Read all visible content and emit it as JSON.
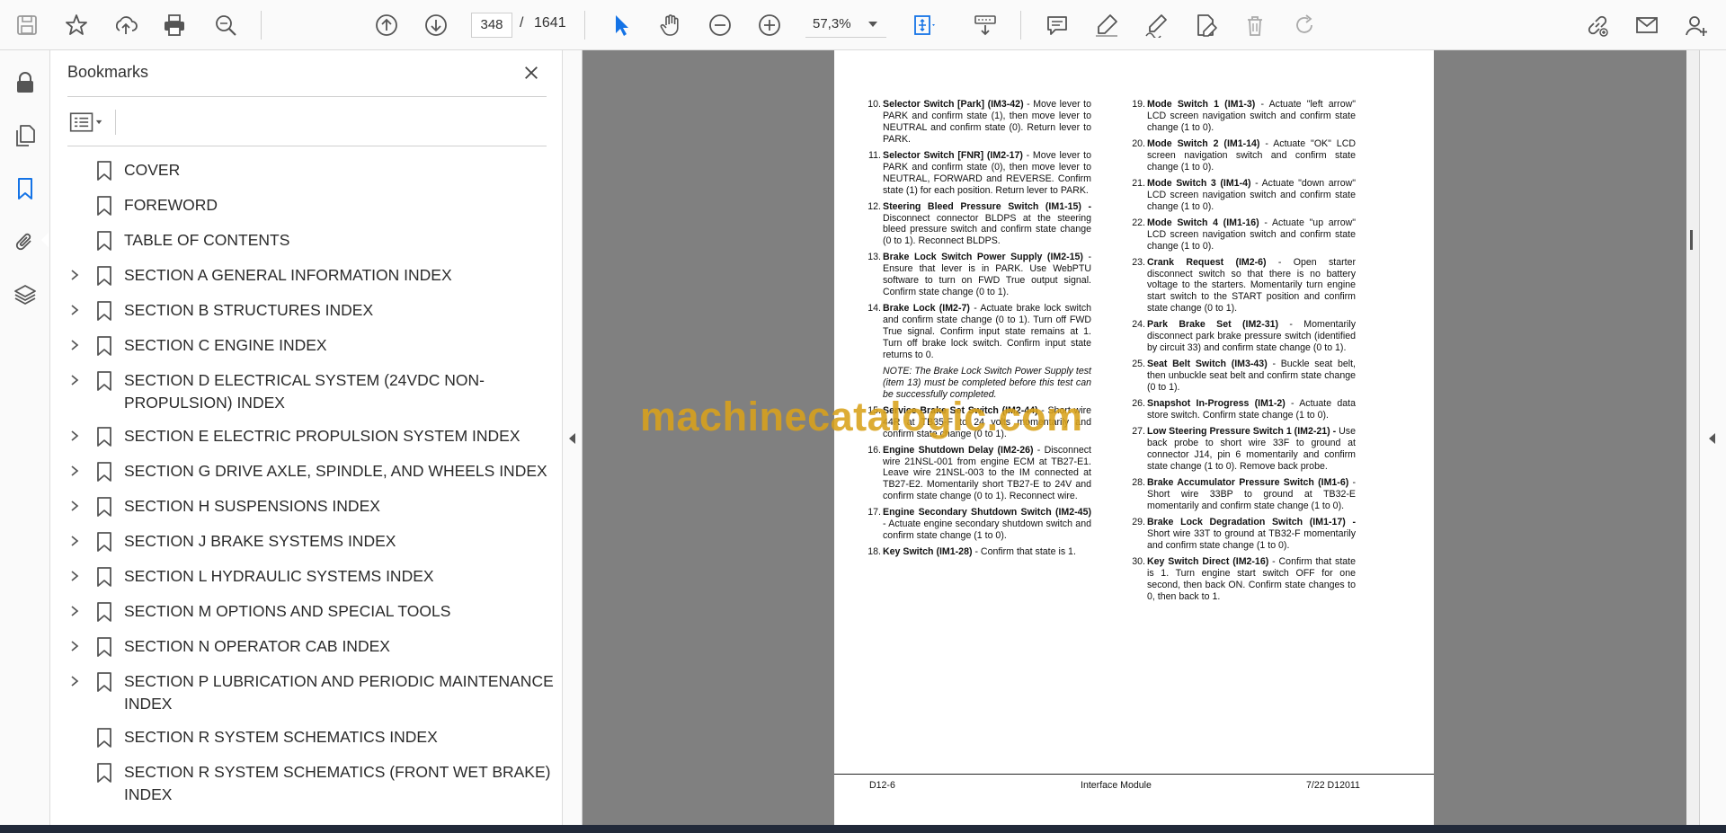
{
  "toolbar": {
    "page_current": "348",
    "page_sep": "/",
    "page_total": "1641",
    "zoom": "57,3%",
    "icons": [
      "save-icon",
      "star-icon",
      "upload-icon",
      "print-icon",
      "zoom-search-icon",
      "arrow-up-icon",
      "arrow-down-icon",
      "select-cursor-icon",
      "hand-icon",
      "zoom-out-icon",
      "zoom-in-icon",
      "fit-page-icon",
      "scroll-mode-icon",
      "comment-icon",
      "highlight-icon",
      "sign-icon",
      "fill-sign-icon",
      "delete-icon",
      "redo-icon",
      "share-link-icon",
      "mail-icon",
      "account-icon"
    ]
  },
  "panel": {
    "title": "Bookmarks",
    "bookmarks": [
      {
        "label": "COVER",
        "expandable": false
      },
      {
        "label": "FOREWORD",
        "expandable": false
      },
      {
        "label": "TABLE OF CONTENTS",
        "expandable": false
      },
      {
        "label": "SECTION A GENERAL INFORMATION INDEX",
        "expandable": true
      },
      {
        "label": "SECTION B STRUCTURES INDEX",
        "expandable": true
      },
      {
        "label": "SECTION C ENGINE INDEX",
        "expandable": true
      },
      {
        "label": "SECTION D ELECTRICAL SYSTEM (24VDC NON-PROPULSION) INDEX",
        "expandable": true
      },
      {
        "label": "SECTION E ELECTRIC PROPULSION SYSTEM INDEX",
        "expandable": true
      },
      {
        "label": "SECTION G DRIVE AXLE, SPINDLE, AND WHEELS INDEX",
        "expandable": true
      },
      {
        "label": "SECTION H SUSPENSIONS INDEX",
        "expandable": true
      },
      {
        "label": "SECTION J BRAKE SYSTEMS INDEX",
        "expandable": true
      },
      {
        "label": "SECTION L HYDRAULIC SYSTEMS INDEX",
        "expandable": true
      },
      {
        "label": "SECTION M OPTIONS AND SPECIAL TOOLS",
        "expandable": true
      },
      {
        "label": "SECTION N OPERATOR CAB INDEX",
        "expandable": true
      },
      {
        "label": "SECTION P LUBRICATION AND PERIODIC MAINTENANCE INDEX",
        "expandable": true
      },
      {
        "label": "SECTION R SYSTEM SCHEMATICS INDEX",
        "expandable": false
      },
      {
        "label": "SECTION R SYSTEM SCHEMATICS (FRONT WET BRAKE) INDEX",
        "expandable": false
      }
    ]
  },
  "document": {
    "left_column": [
      {
        "num": "10.",
        "bold": "Selector Switch [Park] (IM3-42)",
        "text": " - Move lever to PARK and confirm state (1), then move lever to NEUTRAL and confirm state (0). Return lever to PARK."
      },
      {
        "num": "11.",
        "bold": "Selector Switch [FNR] (IM2-17)",
        "text": " - Move lever to PARK and confirm state (0), then move lever to NEUTRAL, FORWARD and REVERSE. Confirm state (1) for each position. Return lever to PARK."
      },
      {
        "num": "12.",
        "bold": "Steering Bleed Pressure Switch (IM1-15) -",
        "text": " Disconnect connector BLDPS at the steering bleed pressure switch and confirm state change (0 to 1). Reconnect BLDPS."
      },
      {
        "num": "13.",
        "bold": "Brake Lock Switch Power Supply (IM2-15)",
        "text": " - Ensure that lever is in PARK. Use WebPTU software to turn on FWD True output signal. Confirm state change (0 to 1)."
      },
      {
        "num": "14.",
        "bold": "Brake Lock (IM2-7)",
        "text": " - Actuate brake lock switch and confirm state change (0 to 1). Turn off FWD True signal. Confirm input state remains at 1. Turn off brake lock switch. Confirm input state returns to 0."
      },
      {
        "note": "NOTE: The Brake Lock Switch Power Supply test (item 13) must be completed before this test can be successfully completed."
      },
      {
        "num": "15.",
        "bold": "Service Brake Set Switch (IM2-44)",
        "text": " - Short wire 44R at TB35-F to 24 volts momentarily and confirm state change (0 to 1)."
      },
      {
        "num": "16.",
        "bold": "Engine Shutdown Delay (IM2-26)",
        "text": " - Disconnect wire 21NSL-001 from engine ECM at TB27-E1. Leave wire 21NSL-003 to the IM connected at TB27-E2. Momentarily short TB27-E to 24V and confirm state change (0 to 1). Reconnect wire."
      },
      {
        "num": "17.",
        "bold": "Engine Secondary Shutdown Switch (IM2-45)",
        "text": " - Actuate engine secondary shutdown switch and confirm state change (1 to 0)."
      },
      {
        "num": "18.",
        "bold": "Key Switch (IM1-28)",
        "text": " - Confirm that state is 1."
      }
    ],
    "right_column": [
      {
        "num": "19.",
        "bold": "Mode Switch 1 (IM1-3)",
        "text": " - Actuate \"left arrow\" LCD screen navigation switch and confirm state change (1 to 0)."
      },
      {
        "num": "20.",
        "bold": "Mode Switch 2 (IM1-14)",
        "text": " - Actuate \"OK\" LCD screen navigation switch and confirm state change (1 to 0)."
      },
      {
        "num": "21.",
        "bold": "Mode Switch 3 (IM1-4)",
        "text": " - Actuate \"down arrow\" LCD screen navigation switch and confirm state change (1 to 0)."
      },
      {
        "num": "22.",
        "bold": "Mode Switch 4 (IM1-16)",
        "text": " - Actuate \"up arrow\" LCD screen navigation switch and confirm state change (1 to 0)."
      },
      {
        "num": "23.",
        "bold": "Crank Request (IM2-6)",
        "text": " - Open starter disconnect switch so that there is no battery voltage to the starters. Momentarily turn engine start switch to the START position and confirm state change (0 to 1)."
      },
      {
        "num": "24.",
        "bold": "Park Brake Set (IM2-31)",
        "text": " - Momentarily disconnect park brake pressure switch (identified by circuit 33) and confirm state change (0 to 1)."
      },
      {
        "num": "25.",
        "bold": "Seat Belt Switch (IM3-43)",
        "text": " - Buckle seat belt, then unbuckle seat belt and confirm state change (0 to 1)."
      },
      {
        "num": "26.",
        "bold": "Snapshot In-Progress (IM1-2)",
        "text": " - Actuate data store switch. Confirm state change (1 to 0)."
      },
      {
        "num": "27.",
        "bold": "Low Steering Pressure Switch 1 (IM2-21) -",
        "text": " Use back probe to short wire 33F to ground at connector J14, pin 6 momentarily and confirm state change (1 to 0). Remove back probe."
      },
      {
        "num": "28.",
        "bold": "Brake Accumulator Pressure Switch (IM1-6)",
        "text": " - Short wire 33BP to ground at TB32-E momentarily and confirm state change (1 to 0)."
      },
      {
        "num": "29.",
        "bold": "Brake Lock Degradation Switch (IM1-17) -",
        "text": " Short wire 33T to ground at TB32-F momentarily and confirm state change (1 to 0)."
      },
      {
        "num": "30.",
        "bold": "Key Switch Direct (IM2-16)",
        "text": " - Confirm that state is 1. Turn engine start switch OFF for one second, then back ON. Confirm state changes to 0, then back to 1."
      }
    ],
    "footer": {
      "left": "D12-6",
      "center": "Interface Module",
      "right": "7/22 D12011"
    },
    "watermark": "machinecatalogic.com"
  }
}
